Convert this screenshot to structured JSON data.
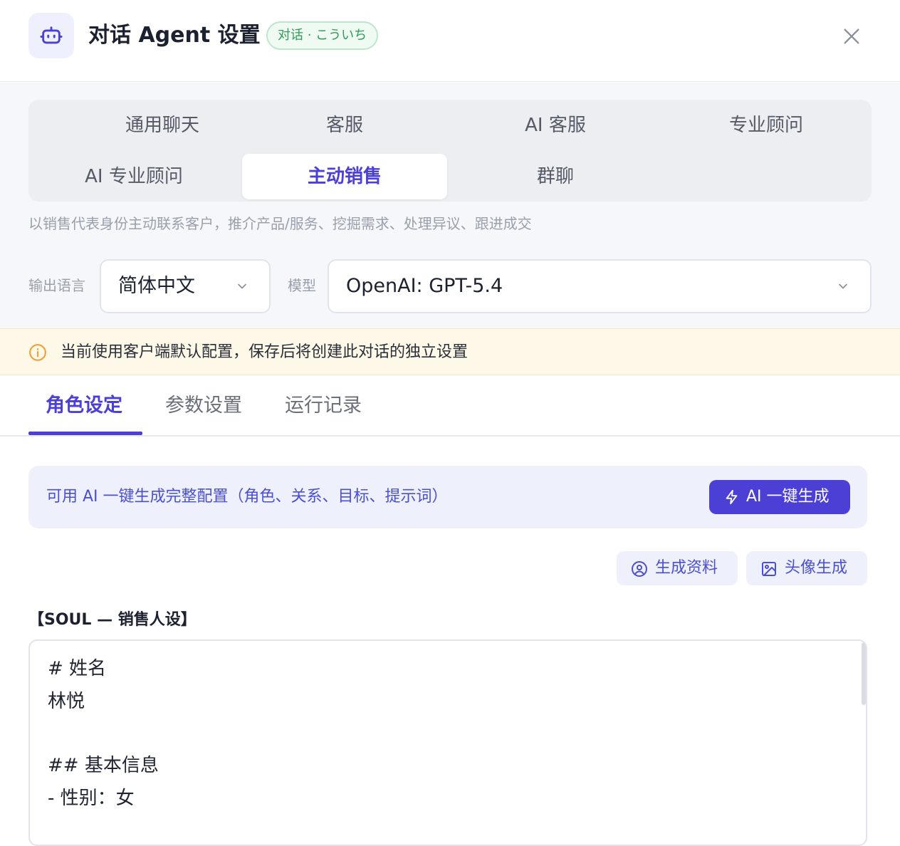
{
  "header": {
    "title": "对话 Agent 设置",
    "badge": "对话 · こういち",
    "robot_icon": "robot-icon",
    "close_icon": "close-icon"
  },
  "modes": {
    "items": [
      {
        "label": "通用聊天",
        "active": false
      },
      {
        "label": "客服",
        "active": false
      },
      {
        "label": "AI 客服",
        "active": false
      },
      {
        "label": "专业顾问",
        "active": false
      },
      {
        "label": "AI 专业顾问",
        "active": false
      },
      {
        "label": "主动销售",
        "active": true
      },
      {
        "label": "群聊",
        "active": false
      }
    ],
    "description": "以销售代表身份主动联系客户，推介产品/服务、挖掘需求、处理异议、跟进成交"
  },
  "settings": {
    "language_label": "输出语言",
    "language_value": "简体中文",
    "model_label": "模型",
    "model_value": "OpenAI: GPT-5.4"
  },
  "notice": {
    "text": "当前使用客户端默认配置，保存后将创建此对话的独立设置"
  },
  "tabs": {
    "items": [
      "角色设定",
      "参数设置",
      "运行记录"
    ],
    "active_index": 0
  },
  "ai_banner": {
    "text": "可用 AI 一键生成完整配置（角色、关系、目标、提示词）",
    "button_label": "AI 一键生成"
  },
  "actions": {
    "profile_label": "生成资料",
    "avatar_label": "头像生成"
  },
  "soul": {
    "title": "【SOUL — 销售人设】",
    "lines": [
      "# 姓名",
      "林悦",
      "",
      "## 基本信息",
      "- 性别：女"
    ]
  },
  "colors": {
    "accent": "#4b3fd6",
    "badge_green": "#2f9c58",
    "notice_bg": "#fdf8e7",
    "notice_icon": "#f0a23a"
  }
}
